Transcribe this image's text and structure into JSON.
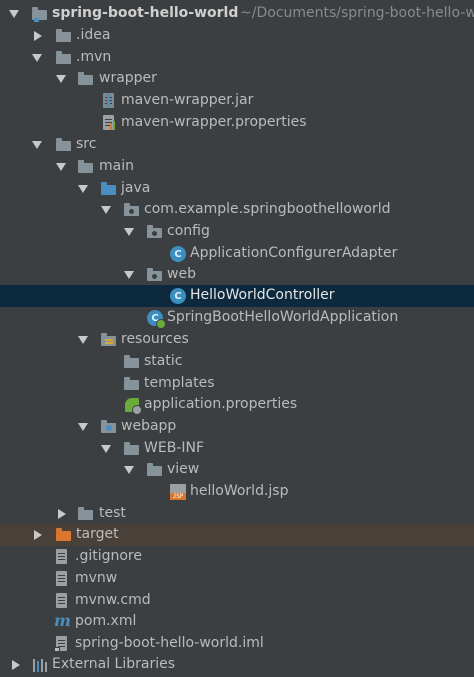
{
  "project": {
    "root_name": "spring-boot-hello-world",
    "root_path": "~/Documents/spring-boot-hello-w"
  },
  "tree": {
    "idea": ".idea",
    "mvn": ".mvn",
    "wrapper": "wrapper",
    "maven_wrapper_jar": "maven-wrapper.jar",
    "maven_wrapper_properties": "maven-wrapper.properties",
    "src": "src",
    "main": "main",
    "java": "java",
    "package": "com.example.springboothelloworld",
    "config": "config",
    "application_configurer_adapter": "ApplicationConfigurerAdapter",
    "web": "web",
    "hello_world_controller": "HelloWorldController",
    "spring_boot_app": "SpringBootHelloWorldApplication",
    "resources": "resources",
    "static": "static",
    "templates": "templates",
    "application_properties": "application.properties",
    "webapp": "webapp",
    "web_inf": "WEB-INF",
    "view": "view",
    "hello_world_jsp": "helloWorld.jsp",
    "test": "test",
    "target": "target",
    "gitignore": ".gitignore",
    "mvnw": "mvnw",
    "mvnw_cmd": "mvnw.cmd",
    "pom": "pom.xml",
    "iml": "spring-boot-hello-world.iml",
    "external_libraries": "External Libraries"
  },
  "icons": {
    "class_letter": "C",
    "jsp_badge": "JSP",
    "maven_letter": "m"
  },
  "colors": {
    "background": "#3c3f41",
    "selected_row": "#0d293e",
    "target_row": "#4a403a",
    "source_folder": "#4a8dbf",
    "excluded_folder": "#d9772f",
    "class_icon": "#3a8fbf",
    "spring_green": "#6aab3a"
  }
}
